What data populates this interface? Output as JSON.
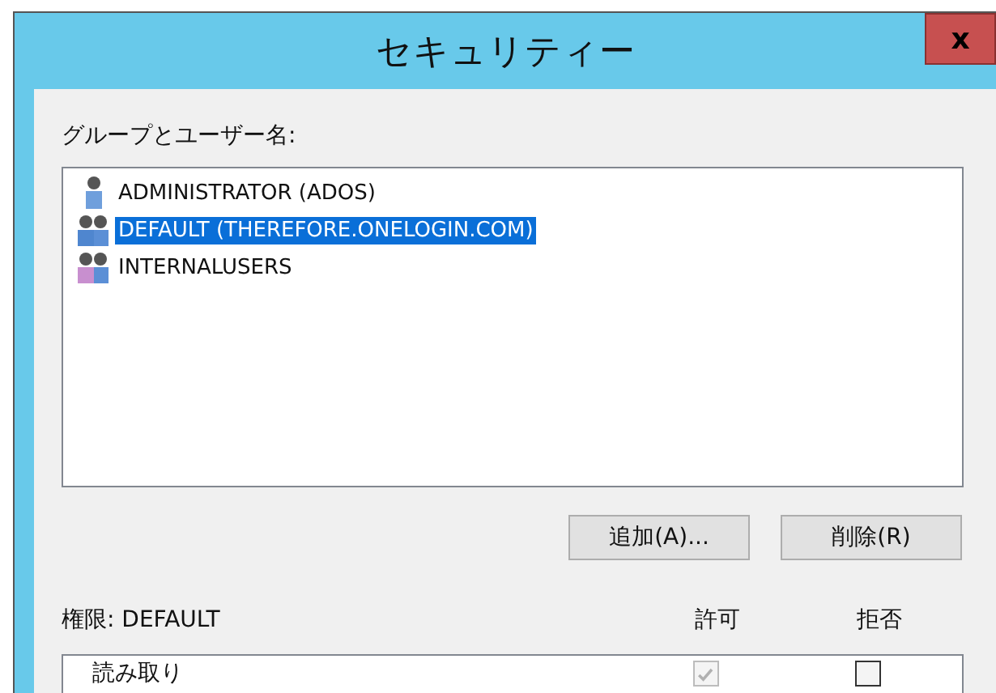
{
  "window": {
    "title": "セキュリティー",
    "close": "x"
  },
  "groups_label": "グループとユーザー名:",
  "principals": [
    {
      "name": "ADMINISTRATOR (ADOS)",
      "kind": "user",
      "color": "#6f9fdc",
      "selected": false
    },
    {
      "name": "DEFAULT (THEREFORE.ONELOGIN.COM)",
      "kind": "group",
      "color": "#4f86cf",
      "selected": true
    },
    {
      "name": "INTERNALUSERS",
      "kind": "group",
      "color": "#c88fcf",
      "selected": false
    }
  ],
  "buttons": [
    "追加(A)...",
    "削除(R)"
  ],
  "permissions": {
    "label": "権限:",
    "principal": "DEFAULT",
    "columns": [
      "許可",
      "拒否"
    ],
    "rows": [
      {
        "name": "読み取り",
        "allow": {
          "checked": true,
          "disabled": true
        },
        "deny": {
          "checked": false,
          "disabled": false
        }
      }
    ]
  }
}
